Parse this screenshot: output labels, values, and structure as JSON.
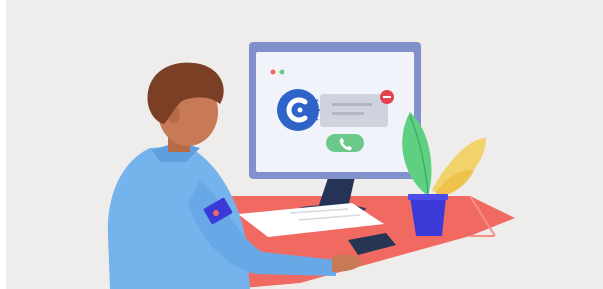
{
  "illustration": {
    "subject": "person-at-computer-receiving-call",
    "colors": {
      "background": "#efedec",
      "desk": "#f06a62",
      "monitor_frame": "#7f8fc9",
      "monitor_screen": "#f1f3fb",
      "app_icon": "#2f63c7",
      "accept_call": "#6bc989",
      "decline_badge": "#e4434d",
      "shirt": "#74b3ec",
      "hair": "#7a3f24",
      "skin": "#c77a55",
      "plant_pot": "#3b3ad9",
      "leaf_green": "#5fcf82",
      "leaf_yellow": "#f2d36b",
      "phone": "#263552"
    }
  }
}
